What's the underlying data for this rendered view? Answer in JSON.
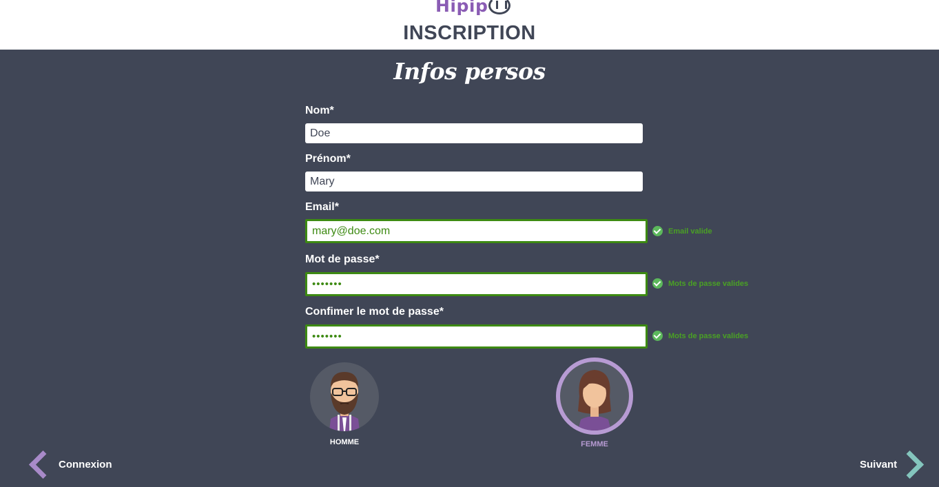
{
  "header": {
    "logo_text": "Hipip",
    "page_title": "INSCRIPTION"
  },
  "section": {
    "title": "Infos persos"
  },
  "form": {
    "nom": {
      "label": "Nom*",
      "value": "Doe"
    },
    "prenom": {
      "label": "Prénom*",
      "value": "Mary"
    },
    "email": {
      "label": "Email*",
      "value": "mary@doe.com",
      "validation": "Email valide"
    },
    "password": {
      "label": "Mot de passe*",
      "value": "•••••••",
      "validation": "Mots de passe valides"
    },
    "password_confirm": {
      "label": "Confimer le mot de passe*",
      "value": "•••••••",
      "validation": "Mots de passe valides"
    }
  },
  "gender": {
    "male_label": "HOMME",
    "female_label": "FEMME",
    "selected": "FEMME"
  },
  "nav": {
    "back_label": "Connexion",
    "next_label": "Suivant"
  },
  "colors": {
    "background": "#404656",
    "valid": "#3d8a12",
    "accent_purple": "#b79bd3",
    "accent_teal": "#84c5bd"
  }
}
